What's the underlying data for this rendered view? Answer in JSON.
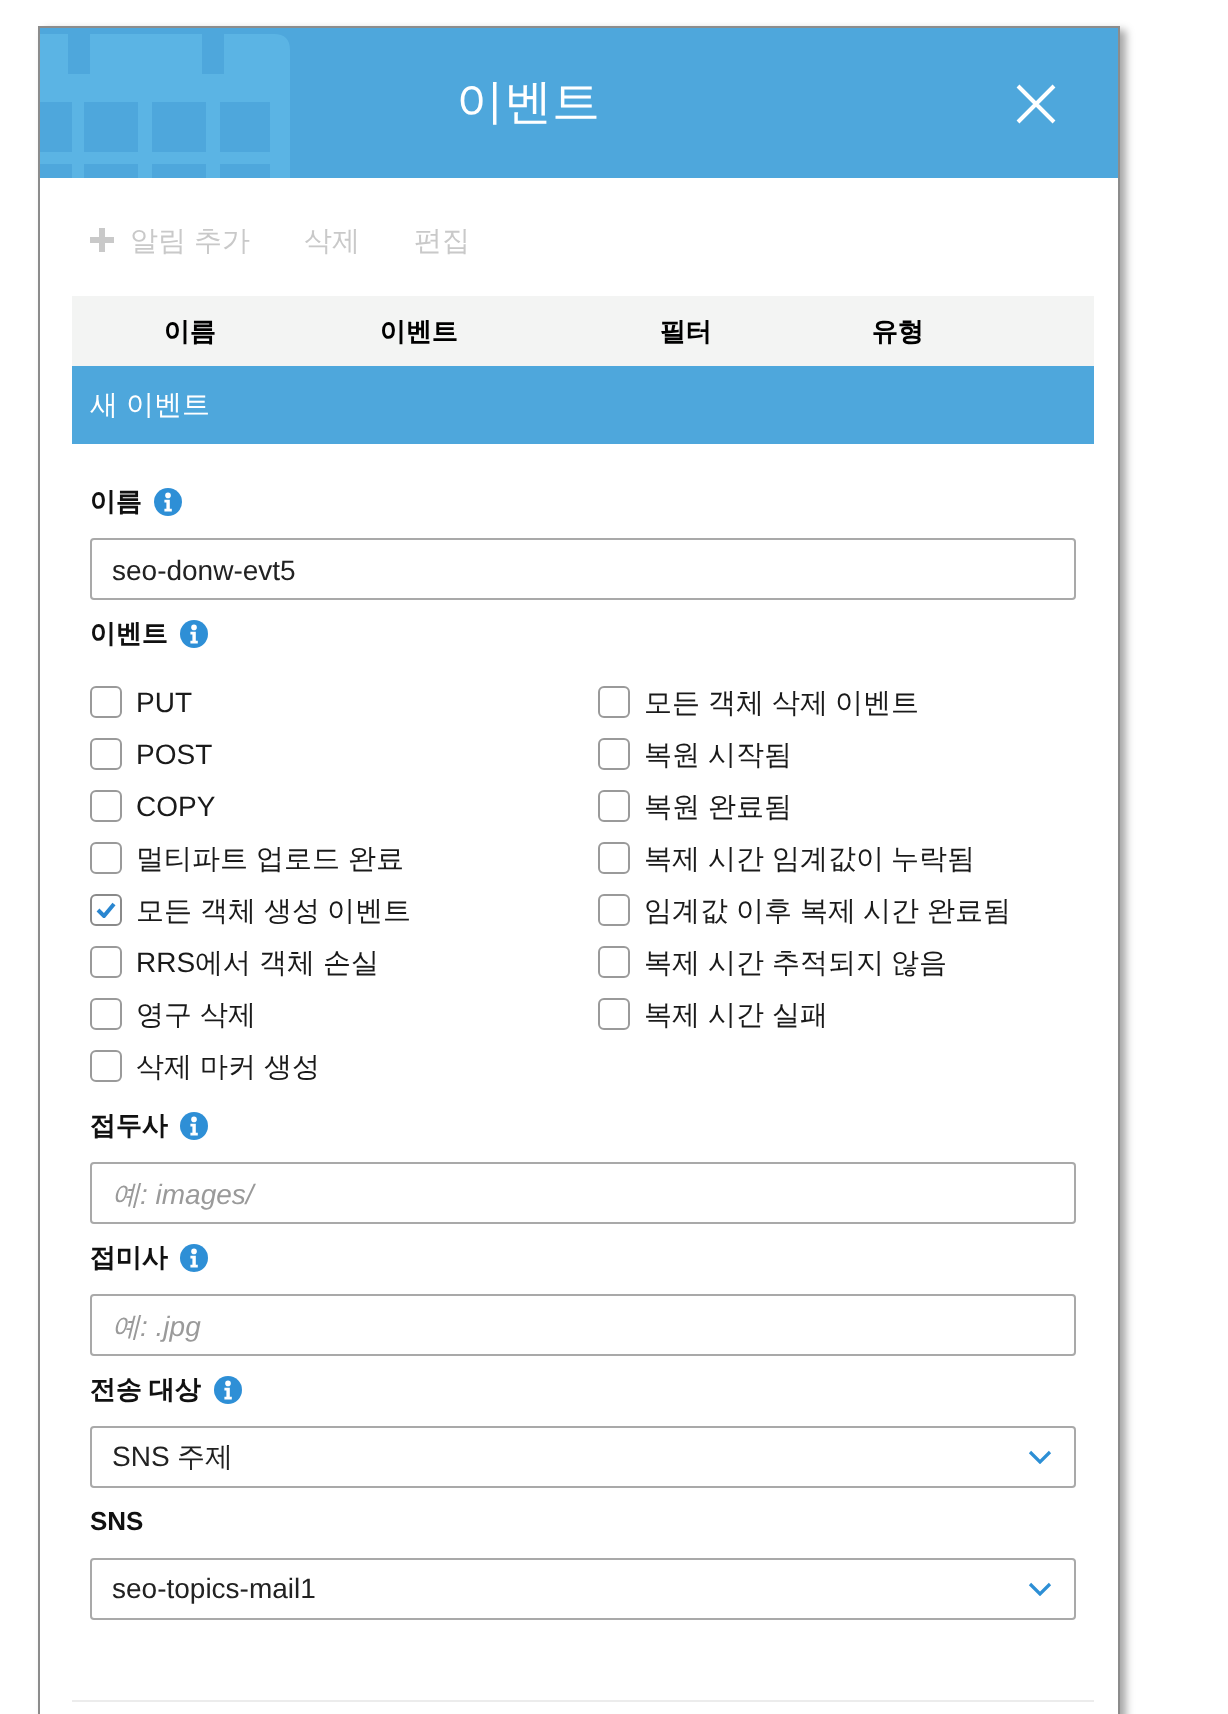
{
  "window": {
    "title": "이벤트"
  },
  "toolbar": [
    {
      "kind": "add",
      "label": "알림 추가",
      "disabled": true
    },
    {
      "kind": "delete",
      "label": "삭제",
      "disabled": true
    },
    {
      "kind": "edit",
      "label": "편집",
      "disabled": true
    }
  ],
  "table": {
    "columns": [
      "이름",
      "이벤트",
      "필터",
      "유형"
    ],
    "rows": [
      {
        "cells": [
          "새 이벤트"
        ],
        "selected": true
      }
    ]
  },
  "form": [
    {
      "kind": "text",
      "label": "이름",
      "info": true,
      "value": "seo-donw-evt5"
    },
    {
      "kind": "checkboxes",
      "label": "이벤트",
      "info": true,
      "columns": [
        [
          {
            "label": "PUT",
            "checked": false
          },
          {
            "label": "POST",
            "checked": false
          },
          {
            "label": "COPY",
            "checked": false
          },
          {
            "label": "멀티파트 업로드 완료",
            "checked": false
          },
          {
            "label": "모든 객체 생성 이벤트",
            "checked": true
          },
          {
            "label": "RRS에서 객체 손실",
            "checked": false
          },
          {
            "label": "영구 삭제",
            "checked": false
          },
          {
            "label": "삭제 마커 생성",
            "checked": false
          }
        ],
        [
          {
            "label": "모든 객체 삭제 이벤트",
            "checked": false
          },
          {
            "label": "복원 시작됨",
            "checked": false
          },
          {
            "label": "복원 완료됨",
            "checked": false
          },
          {
            "label": "복제 시간 임계값이 누락됨",
            "checked": false
          },
          {
            "label": "임계값 이후 복제 시간 완료됨",
            "checked": false
          },
          {
            "label": "복제 시간 추적되지 않음",
            "checked": false
          },
          {
            "label": "복제 시간 실패",
            "checked": false
          }
        ]
      ]
    },
    {
      "kind": "text",
      "label": "접두사",
      "info": true,
      "placeholder": "예: images/"
    },
    {
      "kind": "text",
      "label": "접미사",
      "info": true,
      "placeholder": "예: .jpg"
    },
    {
      "kind": "select",
      "label": "전송 대상",
      "info": true,
      "value": "SNS 주제"
    },
    {
      "kind": "select",
      "label": "SNS",
      "info": false,
      "value": "seo-topics-mail1"
    }
  ]
}
